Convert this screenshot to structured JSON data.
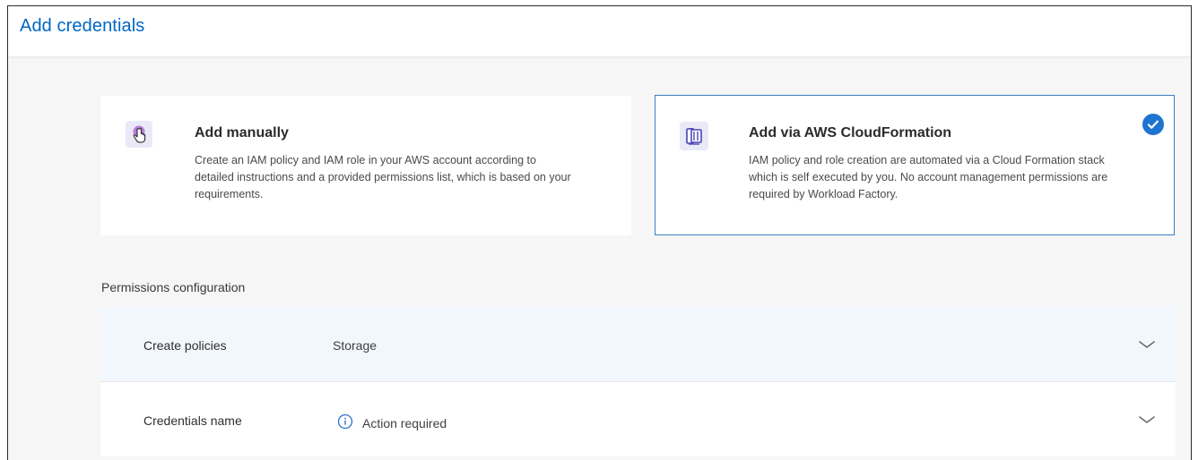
{
  "header": {
    "title": "Add credentials"
  },
  "options": [
    {
      "id": "manual",
      "title": "Add manually",
      "description": "Create an IAM policy and IAM role in your AWS account according to detailed instructions and a provided permissions list, which is based on your requirements.",
      "icon": "hand-pointer-icon",
      "selected": false
    },
    {
      "id": "cloudformation",
      "title": "Add via AWS CloudFormation",
      "description": "IAM policy and role creation are automated via a Cloud Formation stack which is self executed by you. No account management permissions are required by Workload Factory.",
      "icon": "cloudformation-icon",
      "selected": true
    }
  ],
  "permissions": {
    "section_label": "Permissions configuration",
    "rows": [
      {
        "label": "Create policies",
        "value": "Storage"
      },
      {
        "label": "Credentials name",
        "value": "Action required",
        "status_icon": "info-icon"
      }
    ]
  },
  "colors": {
    "accent": "#0067c5",
    "selected_border": "#3d7fc4",
    "check": "#1f74d0",
    "highlight_row": "#f1f7fc"
  }
}
